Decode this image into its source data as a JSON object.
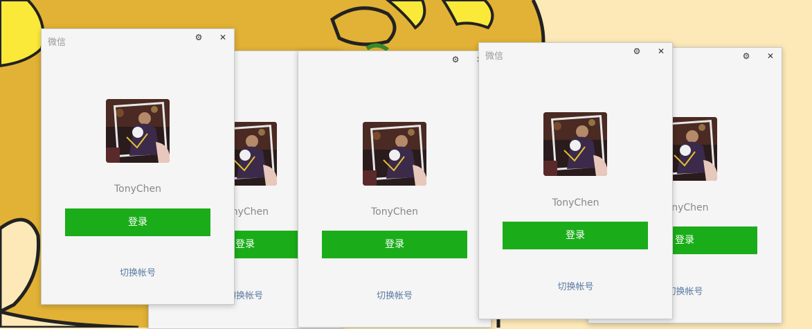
{
  "app": {
    "title": "微信",
    "username": "TonyChen",
    "login_label": "登录",
    "switch_account_label": "切换帐号",
    "settings_icon": "⚙",
    "close_icon": "✕"
  },
  "colors": {
    "login_green": "#1aad19",
    "link_blue": "#5a7aa2",
    "window_bg": "#f5f5f5",
    "wallpaper_yellow": "#e2b236"
  }
}
